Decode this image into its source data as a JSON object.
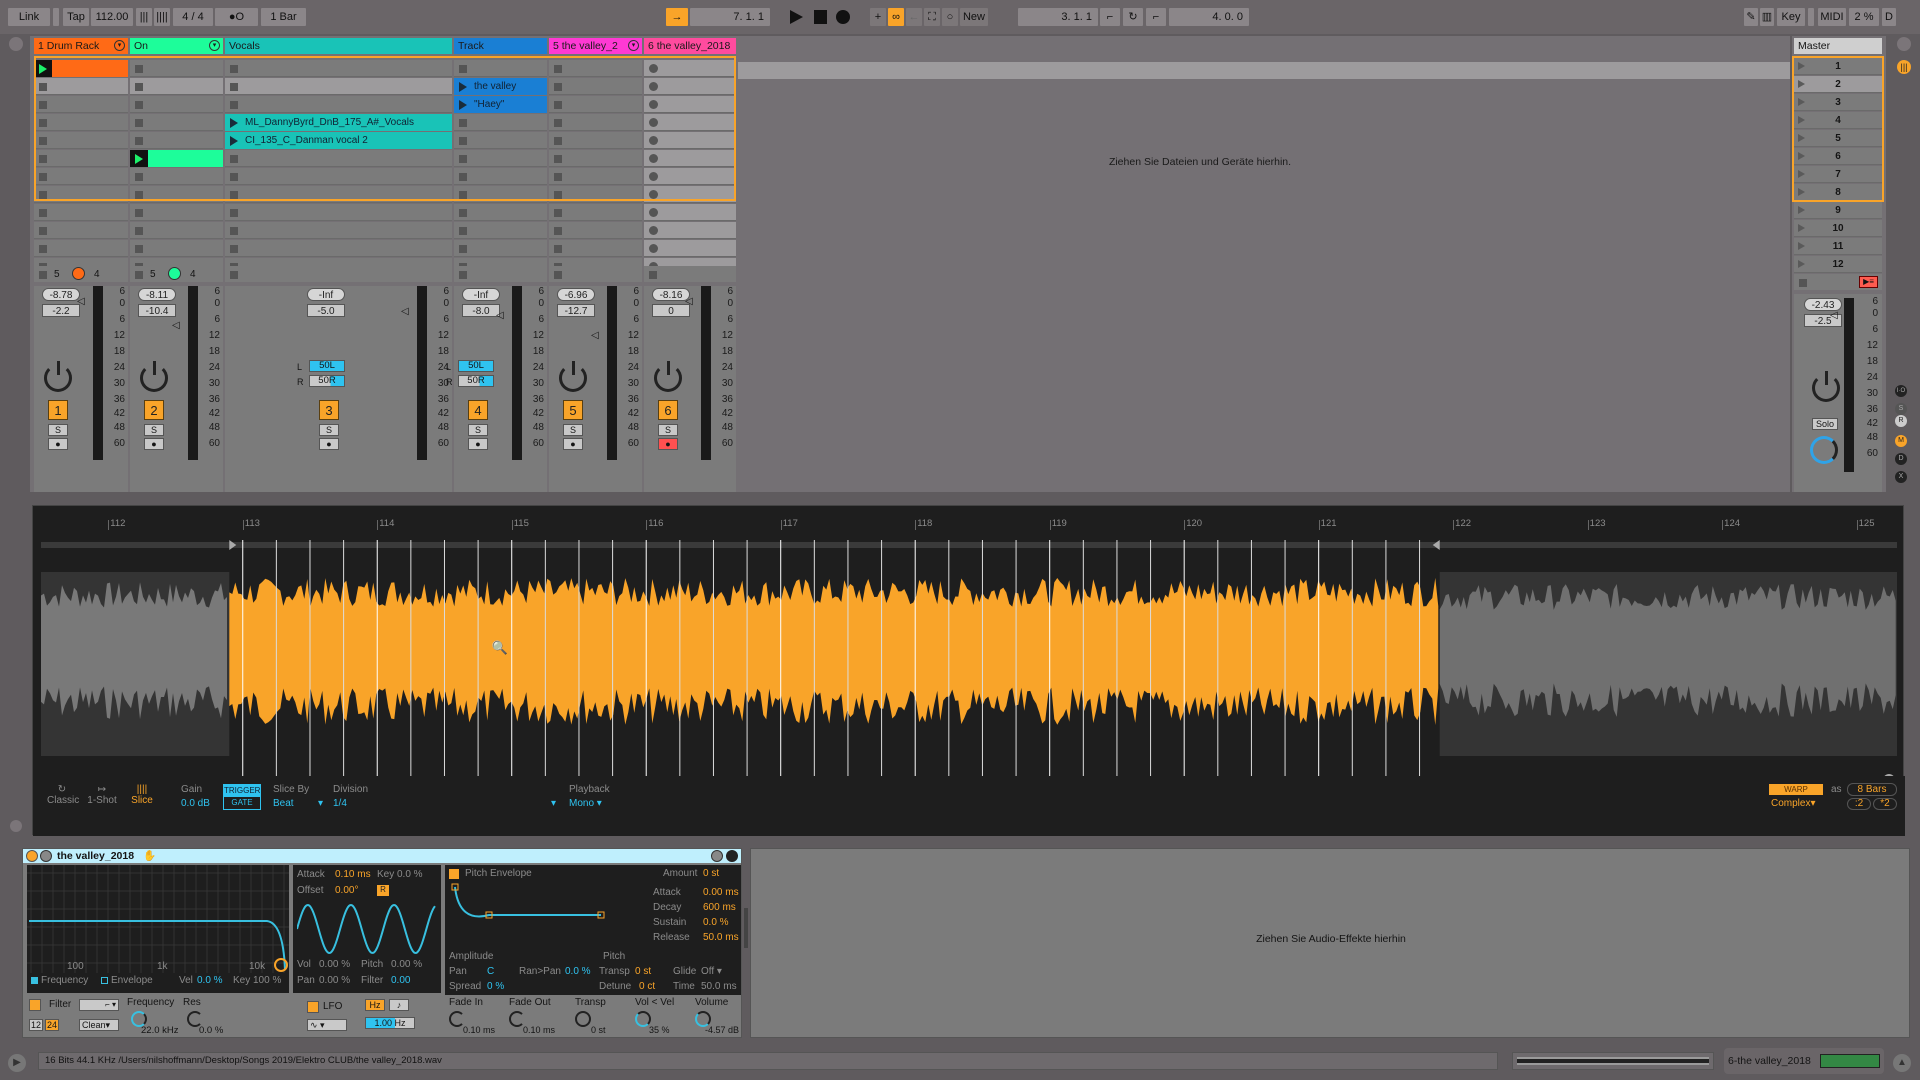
{
  "transport": {
    "link": "Link",
    "tap": "Tap",
    "tempo": "112.00",
    "time_signature": "4 / 4",
    "metronome": "●O",
    "quantize": "1 Bar",
    "follow_icon": "follow-arrow-icon",
    "position": "7.   1.   1",
    "new_label": "New",
    "loop_start": "3.   1.   1",
    "loop_length": "4.   0.   0",
    "key_label": "Key",
    "midi_label": "MIDI",
    "cpu": "2 %",
    "d_label": "D"
  },
  "tracks": [
    {
      "name": "1 Drum Rack",
      "color": "#ff6a16",
      "number": "1",
      "vol_peak": "-8.78",
      "vol": "-2.2",
      "sends_left": "5",
      "sends_right": "4"
    },
    {
      "name": "On",
      "color": "#1dfd9a",
      "number": "2",
      "vol_peak": "-8.11",
      "vol": "-10.4",
      "sends_left": "5",
      "sends_right": "4"
    },
    {
      "name": "Vocals",
      "color": "#19c3b7",
      "number": "3",
      "vol_peak": "-Inf",
      "vol": "-5.0",
      "pan_l": "50L",
      "pan_r": "50R"
    },
    {
      "name": "Track",
      "color": "#1a7fd4",
      "number": "4",
      "vol_peak": "-Inf",
      "vol": "-8.0",
      "pan_l": "50L",
      "pan_r": "50R"
    },
    {
      "name": "5 the valley_2",
      "color": "#ff39d4",
      "number": "5",
      "vol_peak": "-6.96",
      "vol": "-12.7"
    },
    {
      "name": "6 the valley_2018",
      "color": "#ff4b9e",
      "number": "6",
      "vol_peak": "-8.16",
      "vol": "0"
    }
  ],
  "clips": {
    "track3_clip1": "ML_DannyByrd_DnB_175_A#_Vocals",
    "track3_clip2": "CI_135_C_Danman vocal 2",
    "track4_clip1": "the valley",
    "track4_clip2": "\"Haey\""
  },
  "session_drop_hint": "Ziehen Sie Dateien und Geräte hierhin.",
  "master": {
    "name": "Master",
    "scenes": [
      "1",
      "2",
      "3",
      "4",
      "5",
      "6",
      "7",
      "8",
      "9",
      "10",
      "11",
      "12"
    ],
    "vol_peak": "-2.43",
    "vol": "-2.5",
    "solo_label": "Solo"
  },
  "meter_scale": [
    "6",
    "0",
    "6",
    "12",
    "18",
    "24",
    "30",
    "36",
    "42",
    "48",
    "60"
  ],
  "side_buttons": [
    "I·O",
    "S",
    "R",
    "M",
    "D",
    "X"
  ],
  "detail": {
    "ruler": [
      "112",
      "113",
      "114",
      "115",
      "116",
      "117",
      "118",
      "119",
      "120",
      "121",
      "122",
      "123",
      "124",
      "125"
    ],
    "modes": {
      "classic": "Classic",
      "oneshot": "1-Shot",
      "slice": "Slice"
    },
    "gain_label": "Gain",
    "gain_value": "0.0 dB",
    "trigger": "TRIGGER",
    "gate": "GATE",
    "slice_by_label": "Slice By",
    "slice_by_value": "Beat",
    "division_label": "Division",
    "division_value": "1/4",
    "playback_label": "Playback",
    "playback_value": "Mono",
    "warp": "WARP",
    "as": "as",
    "bars": "8 Bars",
    "warp_mode": "Complex",
    "half": ":2",
    "double": "*2"
  },
  "simpler": {
    "title": "the valley_2018",
    "filter_ticks": [
      "100",
      "1k",
      "10k"
    ],
    "frequency_tab": "Frequency",
    "envelope_tab": "Envelope",
    "vel_label": "Vel",
    "vel_value": "0.0 %",
    "key_label": "Key",
    "key_value": "100 %",
    "filter_label": "Filter",
    "filter_slope_12": "12",
    "filter_slope_24": "24",
    "filter_circuit": "Clean",
    "freq_label": "Frequency",
    "freq_value": "22.0 kHz",
    "res_label": "Res",
    "res_value": "0.0 %",
    "lfo_attack_label": "Attack",
    "lfo_attack_value": "0.10 ms",
    "lfo_key_label": "Key",
    "lfo_key_value": "0.0 %",
    "lfo_offset_label": "Offset",
    "lfo_offset_value": "0.00°",
    "lfo_r": "R",
    "lfo_vol_label": "Vol",
    "lfo_vol_value": "0.00 %",
    "lfo_pitch_label": "Pitch",
    "lfo_pitch_value": "0.00 %",
    "lfo_pan_label": "Pan",
    "lfo_pan_value": "0.00 %",
    "lfo_filter_label": "Filter",
    "lfo_filter_value": "0.00",
    "lfo_label": "LFO",
    "lfo_hz": "Hz",
    "lfo_rate": "1.00 Hz",
    "penv_label": "Pitch Envelope",
    "amount_label": "Amount",
    "amount_value": "0 st",
    "attack_label": "Attack",
    "attack_value": "0.00 ms",
    "decay_label": "Decay",
    "decay_value": "600 ms",
    "sustain_label": "Sustain",
    "sustain_value": "0.0 %",
    "release_label": "Release",
    "release_value": "50.0 ms",
    "amplitude_label": "Amplitude",
    "pitch_label": "Pitch",
    "pan_label": "Pan",
    "pan_value": "C",
    "ranpan_label": "Ran>Pan",
    "ranpan_value": "0.0 %",
    "spread_label": "Spread",
    "spread_value": "0 %",
    "transp_label": "Transp",
    "transp_value": "0 st",
    "detune_label": "Detune",
    "detune_value": "0 ct",
    "glide_label": "Glide",
    "glide_value": "Off",
    "time_label": "Time",
    "time_value": "50.0 ms",
    "fadein_label": "Fade In",
    "fadein_value": "0.10 ms",
    "fadeout_label": "Fade Out",
    "fadeout_value": "0.10 ms",
    "ktransp_label": "Transp",
    "ktransp_value": "0 st",
    "volvel_label": "Vol < Vel",
    "volvel_value": "35 %",
    "volume_label": "Volume",
    "volume_value": "-4.57 dB"
  },
  "fx_drop_hint": "Ziehen Sie Audio-Effekte hierhin",
  "status": {
    "file_info": "16 Bits 44.1 KHz /Users/nilshoffmann/Desktop/Songs 2019/Elektro CLUB/the valley_2018.wav",
    "selected_track": "6-the valley_2018"
  },
  "colors": {
    "accent": "#f9a429",
    "blue_value": "#2fc3f0",
    "waveform": "#f9a429"
  }
}
